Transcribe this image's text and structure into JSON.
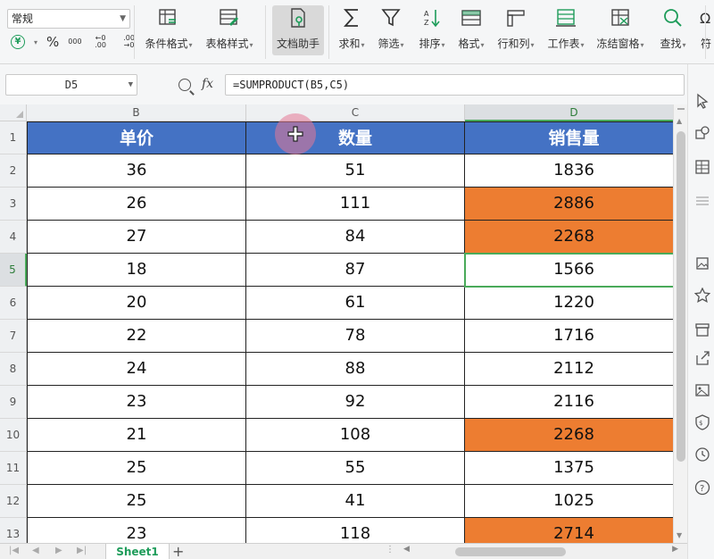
{
  "ribbon": {
    "number_format": "常规",
    "currency_symbol": "¥",
    "percent_symbol": "%",
    "thousands_symbol": "000",
    "increase_decimal": "←0 .00",
    "decrease_decimal": ".00 →0",
    "buttons": [
      {
        "label": "条件格式",
        "icon": "conditional-format-icon",
        "dropdown": true
      },
      {
        "label": "表格样式",
        "icon": "table-style-icon",
        "dropdown": true
      },
      {
        "label": "文档助手",
        "icon": "doc-assistant-icon",
        "dropdown": false,
        "active": true
      },
      {
        "label": "求和",
        "icon": "sum-icon",
        "dropdown": true
      },
      {
        "label": "筛选",
        "icon": "filter-icon",
        "dropdown": true
      },
      {
        "label": "排序",
        "icon": "sort-icon",
        "dropdown": true
      },
      {
        "label": "格式",
        "icon": "format-icon",
        "dropdown": true
      },
      {
        "label": "行和列",
        "icon": "rows-cols-icon",
        "dropdown": true
      },
      {
        "label": "工作表",
        "icon": "worksheet-icon",
        "dropdown": true
      },
      {
        "label": "冻结窗格",
        "icon": "freeze-panes-icon",
        "dropdown": true
      },
      {
        "label": "查找",
        "icon": "find-icon",
        "dropdown": true
      },
      {
        "label": "符",
        "icon": "symbol-icon",
        "dropdown": false
      }
    ],
    "dropdown_marker": "▾"
  },
  "formula_bar": {
    "name_box": "D5",
    "fx_label": "fx",
    "formula": "=SUMPRODUCT(B5,C5)"
  },
  "sheet": {
    "columns": [
      "B",
      "C",
      "D"
    ],
    "selected_column": "D",
    "header_row": {
      "row": "1",
      "cells": [
        "单价",
        "数量",
        "销售量"
      ]
    },
    "rows": [
      {
        "row": "2",
        "cells": [
          "36",
          "51",
          "1836"
        ],
        "highlight": false
      },
      {
        "row": "3",
        "cells": [
          "26",
          "111",
          "2886"
        ],
        "highlight": true
      },
      {
        "row": "4",
        "cells": [
          "27",
          "84",
          "2268"
        ],
        "highlight": true
      },
      {
        "row": "5",
        "cells": [
          "18",
          "87",
          "1566"
        ],
        "highlight": false
      },
      {
        "row": "6",
        "cells": [
          "20",
          "61",
          "1220"
        ],
        "highlight": false
      },
      {
        "row": "7",
        "cells": [
          "22",
          "78",
          "1716"
        ],
        "highlight": false
      },
      {
        "row": "8",
        "cells": [
          "24",
          "88",
          "2112"
        ],
        "highlight": false
      },
      {
        "row": "9",
        "cells": [
          "23",
          "92",
          "2116"
        ],
        "highlight": false
      },
      {
        "row": "10",
        "cells": [
          "21",
          "108",
          "2268"
        ],
        "highlight": true
      },
      {
        "row": "11",
        "cells": [
          "25",
          "55",
          "1375"
        ],
        "highlight": false
      },
      {
        "row": "12",
        "cells": [
          "25",
          "41",
          "1025"
        ],
        "highlight": false
      },
      {
        "row": "13",
        "cells": [
          "23",
          "118",
          "2714"
        ],
        "highlight": true
      }
    ],
    "active_row": "5",
    "active_column": "D"
  },
  "colors": {
    "header_fill": "#4472c4",
    "highlight_fill": "#ed7d31",
    "selection": "#4aaa5a",
    "tab_text": "#1e9c5a"
  },
  "tabs": {
    "sheets": [
      "Sheet1"
    ],
    "add_label": "+"
  },
  "side_panel_icons": [
    "cursor-icon",
    "shapes-icon",
    "table-icon",
    "settings-icon",
    "image-gallery-icon",
    "star-icon",
    "archive-icon",
    "share-icon",
    "picture-icon",
    "shield-icon",
    "history-icon",
    "help-icon"
  ]
}
